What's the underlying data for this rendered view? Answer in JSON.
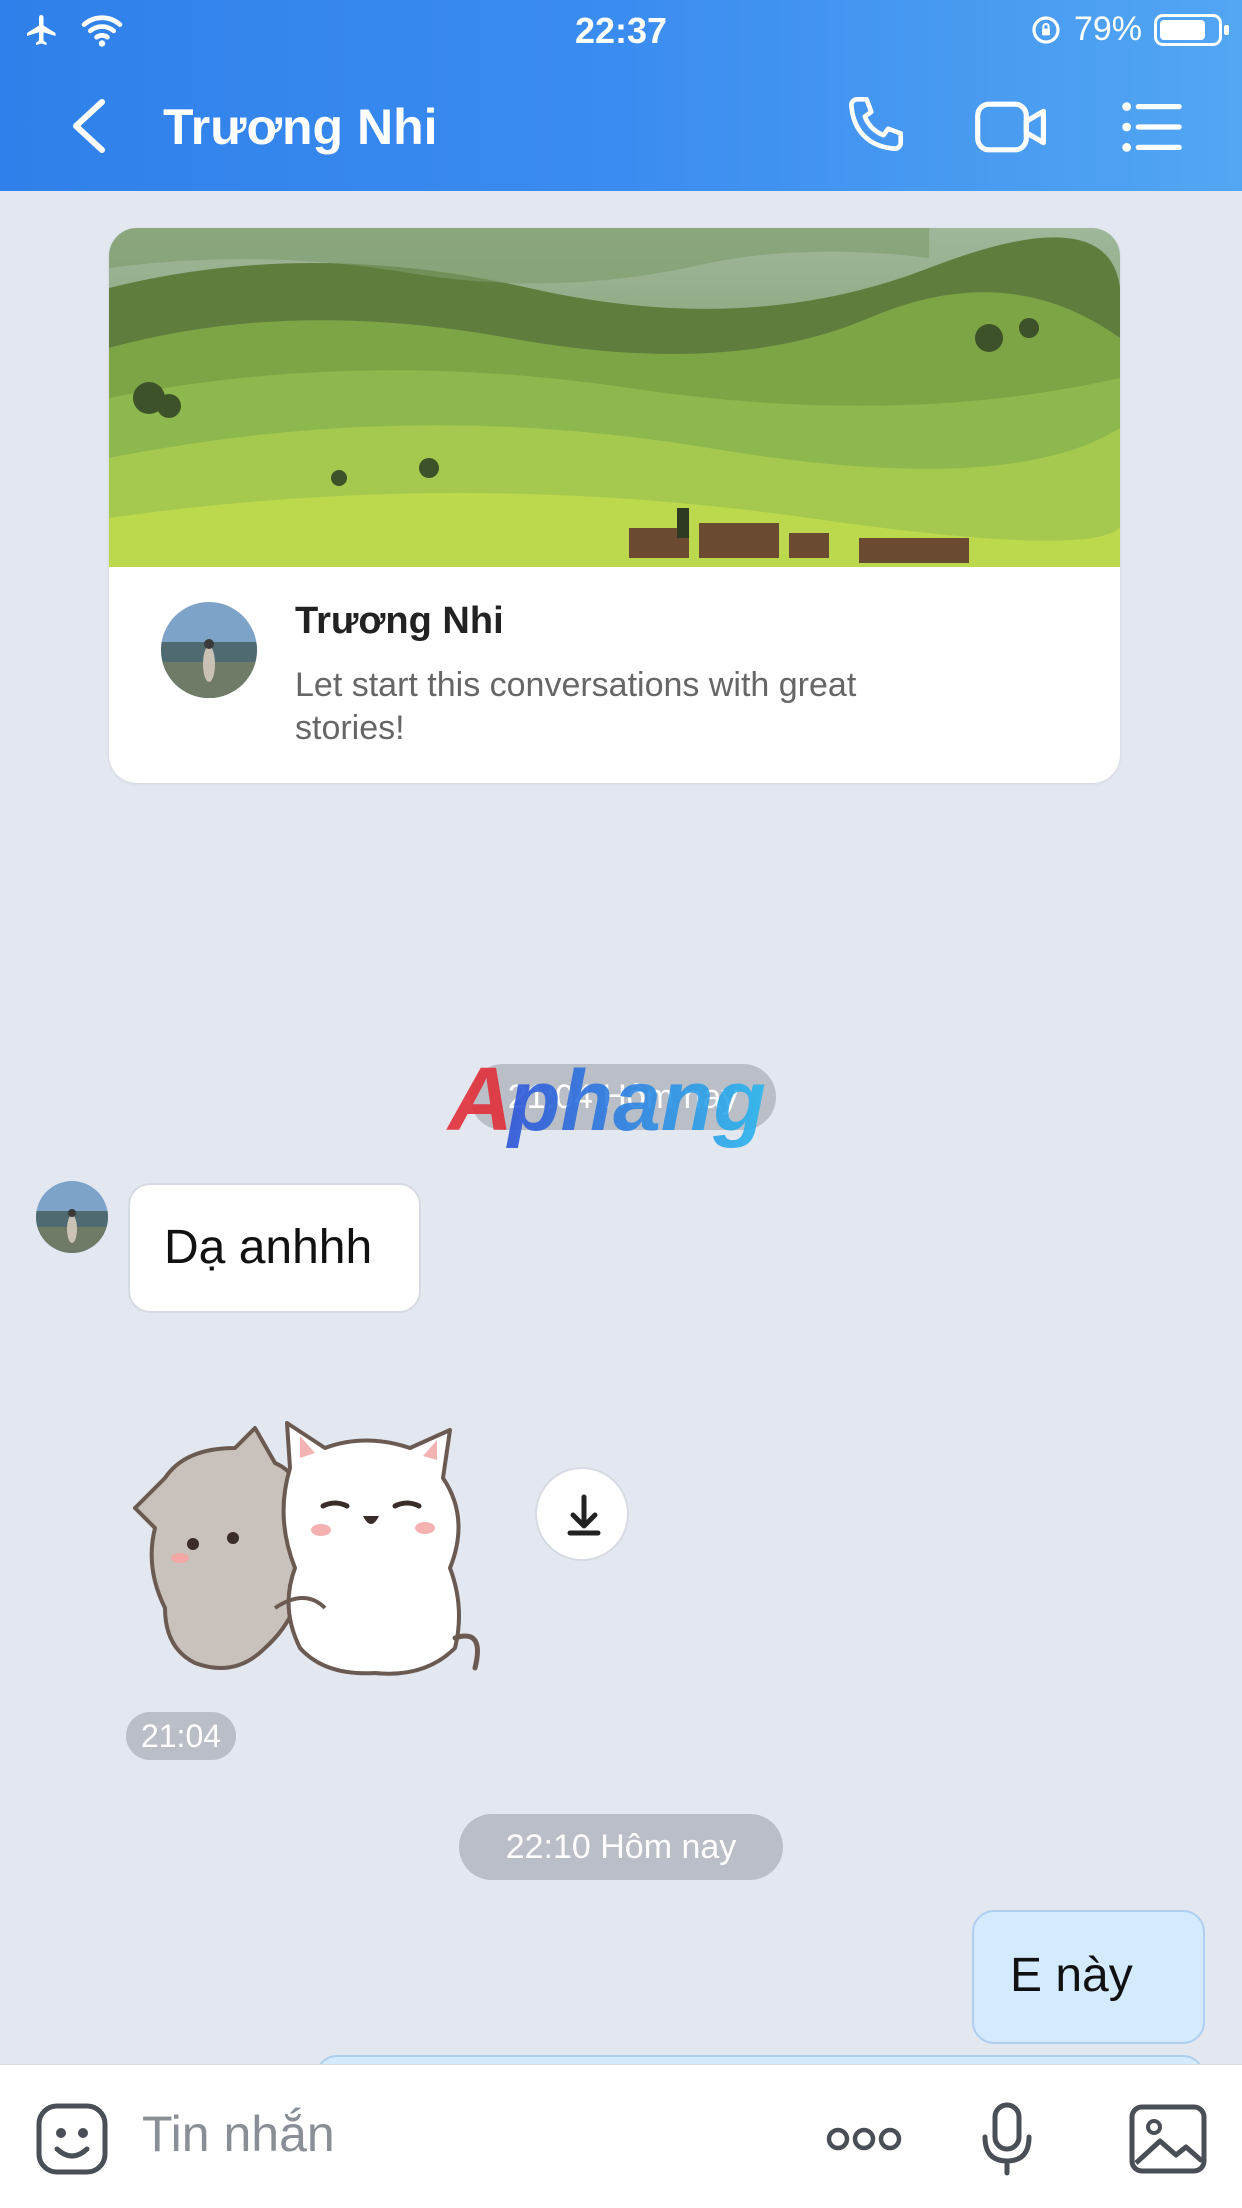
{
  "status_bar": {
    "time": "22:37",
    "battery": "79%",
    "battery_level": 0.79
  },
  "header": {
    "title": "Trương Nhi"
  },
  "intro_card": {
    "name": "Trương Nhi",
    "description": "Let start this conversations with great stories!"
  },
  "watermark": {
    "text": "Aphang"
  },
  "messages": {
    "pill_1": "21:04 Hôm nay",
    "incoming_text": "Dạ anhhh",
    "sticker_time": "21:04",
    "pill_2": "22:10 Hôm nay",
    "outgoing_text": "E này"
  },
  "composer": {
    "placeholder": "Tin nhắn"
  },
  "colors": {
    "header_start": "#2f80ea",
    "header_end": "#52a6f2",
    "background": "#e3e7ef",
    "outgoing_bubble": "#d4eaff"
  }
}
